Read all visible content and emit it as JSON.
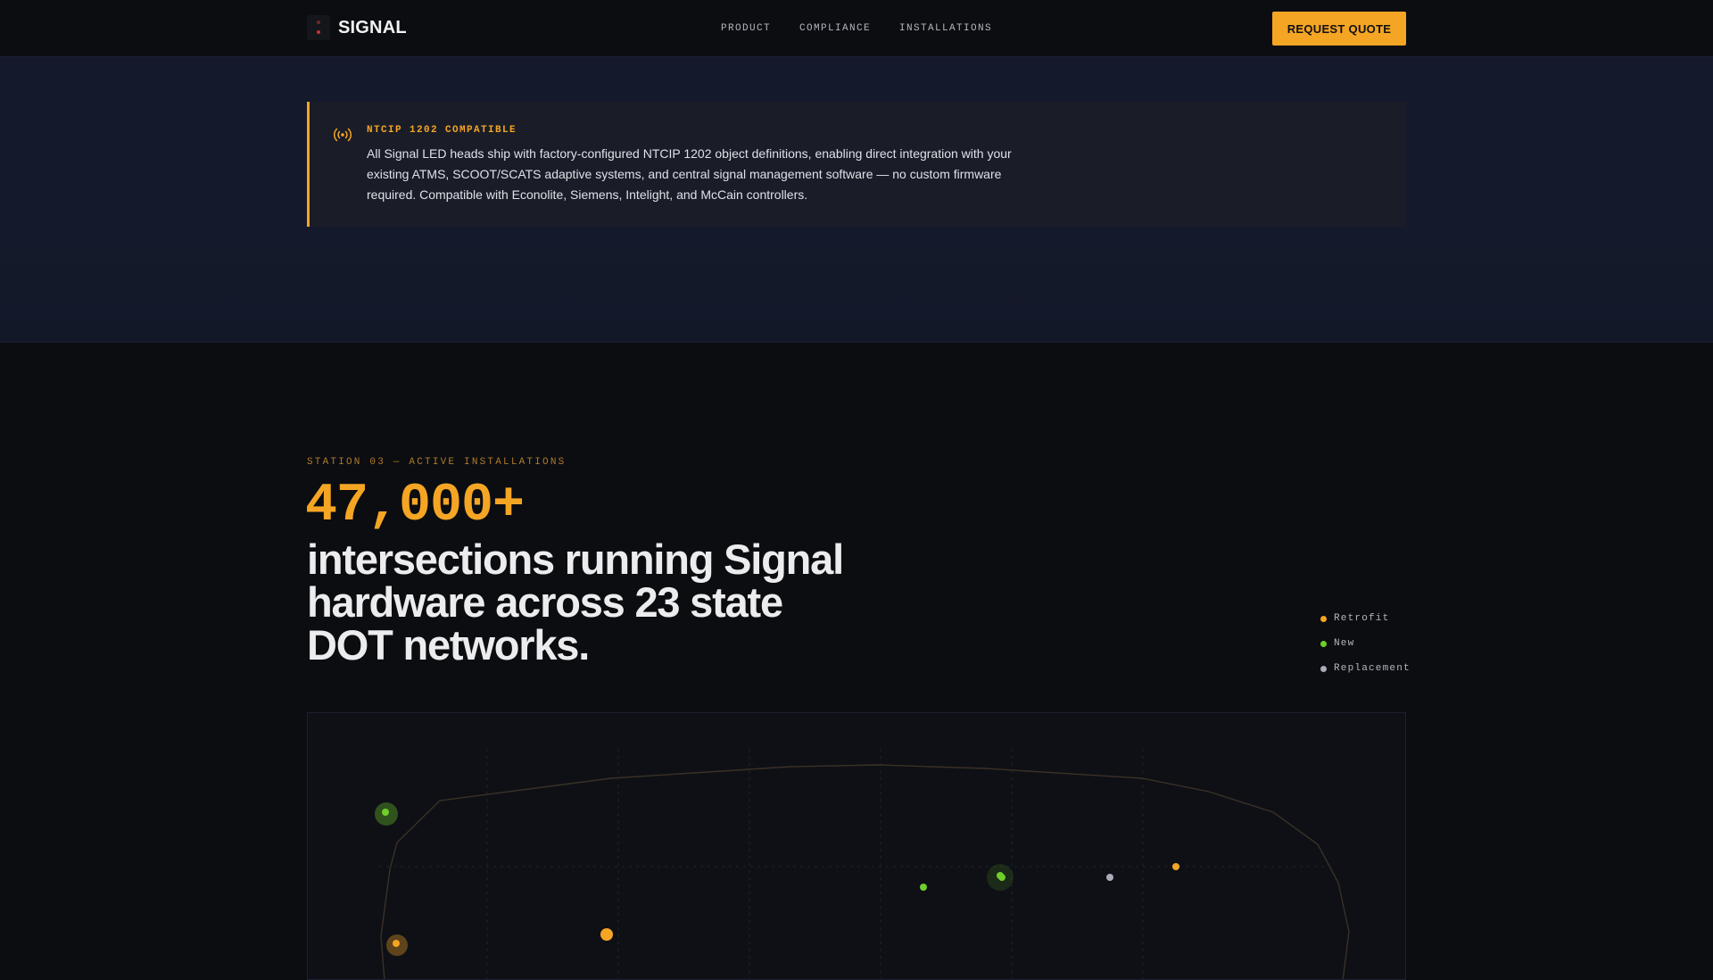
{
  "nav": {
    "brand": "SIGNAL",
    "links": [
      "PRODUCT",
      "COMPLIANCE",
      "INSTALLATIONS"
    ],
    "cta": "REQUEST QUOTE"
  },
  "notice": {
    "icon": "broadcast-icon",
    "title": "NTCIP 1202 COMPATIBLE",
    "body": "All Signal LED heads ship with factory-configured NTCIP 1202 object definitions, enabling direct integration with your existing ATMS, SCOOT/SCATS adaptive systems, and central signal management software — no custom firmware required. Compatible with Econolite, Siemens, Intelight, and McCain controllers."
  },
  "stats": {
    "eyebrow": "STATION 03 — ACTIVE INSTALLATIONS",
    "big_number": "47,000+",
    "headline": "intersections running Signal hardware across 23 state DOT networks."
  },
  "legend": [
    {
      "label": "Retrofit",
      "color": "#f5a524"
    },
    {
      "label": "New",
      "color": "#6fcf2a"
    },
    {
      "label": "Replacement",
      "color": "#a9adb8"
    }
  ],
  "colors": {
    "accent": "#f5a524",
    "new": "#6fcf2a",
    "replacement": "#a9adb8"
  }
}
